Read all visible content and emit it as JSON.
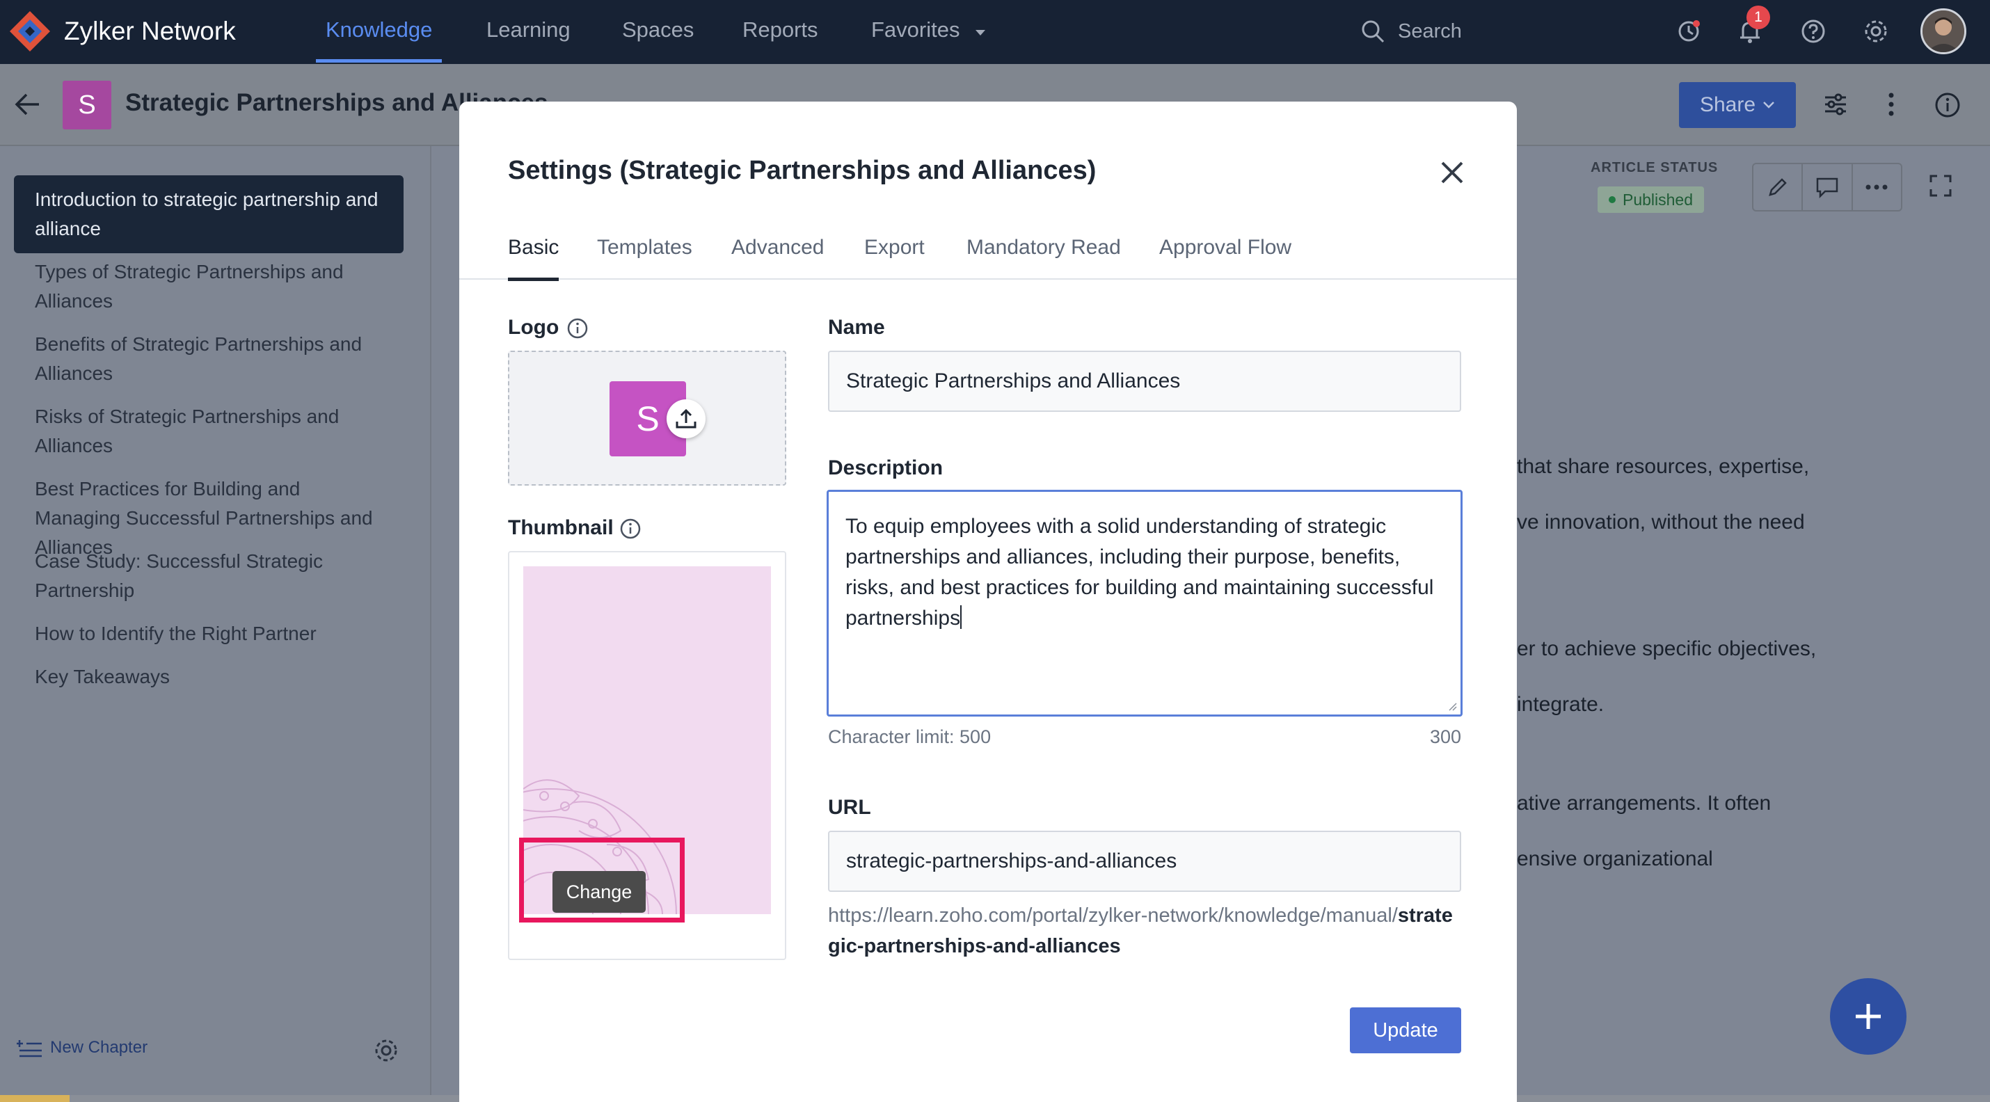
{
  "app": {
    "brand": "Zylker Network",
    "nav_tabs": [
      {
        "label": "Knowledge",
        "active": true
      },
      {
        "label": "Learning"
      },
      {
        "label": "Spaces"
      },
      {
        "label": "Reports"
      },
      {
        "label": "Favorites"
      }
    ],
    "search_placeholder": "Search",
    "notification_count": "1"
  },
  "header": {
    "book_initial": "S",
    "book_title": "Strategic Partnerships and Alliances",
    "share_label": "Share"
  },
  "sidebar": {
    "items": [
      {
        "label": "Introduction to strategic partnership and alliance",
        "active": true
      },
      {
        "label": "Types of Strategic Partnerships and Alliances"
      },
      {
        "label": "Benefits of Strategic Partnerships and Alliances"
      },
      {
        "label": "Risks of Strategic Partnerships and Alliances"
      },
      {
        "label": "Best Practices for Building and Managing Successful Partnerships and Alliances"
      },
      {
        "label": "Case Study: Successful Strategic Partnership"
      },
      {
        "label": "How to Identify the Right Partner"
      },
      {
        "label": "Key Takeaways"
      }
    ],
    "new_chapter_label": "New Chapter"
  },
  "article": {
    "status_label": "ARTICLE STATUS",
    "status_value": "Published",
    "fragments": [
      "that share resources, expertise,",
      "ve innovation, without the need",
      "er to achieve specific objectives,",
      "integrate.",
      "ative arrangements. It often",
      "ensive organizational"
    ]
  },
  "modal": {
    "title": "Settings (Strategic Partnerships and Alliances)",
    "tabs": [
      {
        "label": "Basic",
        "active": true
      },
      {
        "label": "Templates"
      },
      {
        "label": "Advanced"
      },
      {
        "label": "Export"
      },
      {
        "label": "Mandatory Read"
      },
      {
        "label": "Approval Flow"
      }
    ],
    "logo_label": "Logo",
    "logo_initial": "S",
    "thumbnail_label": "Thumbnail",
    "change_label": "Change",
    "name_label": "Name",
    "name_value": "Strategic Partnerships and Alliances",
    "description_label": "Description",
    "description_value": "To equip employees with a solid understanding of strategic partnerships and alliances, including their purpose, benefits, risks, and best practices for building and maintaining successful partnerships",
    "char_limit": "Character limit: 500",
    "char_count": "300",
    "url_label": "URL",
    "url_value": "strategic-partnerships-and-alliances",
    "url_prefix": "https://learn.zoho.com/portal/zylker-network/knowledge/manual/",
    "url_slug": "strategic-partnerships-and-alliances",
    "update_label": "Update"
  },
  "colors": {
    "accent": "#4d6fd4",
    "highlight": "#e8175d",
    "book_icon": "#c553c3"
  }
}
